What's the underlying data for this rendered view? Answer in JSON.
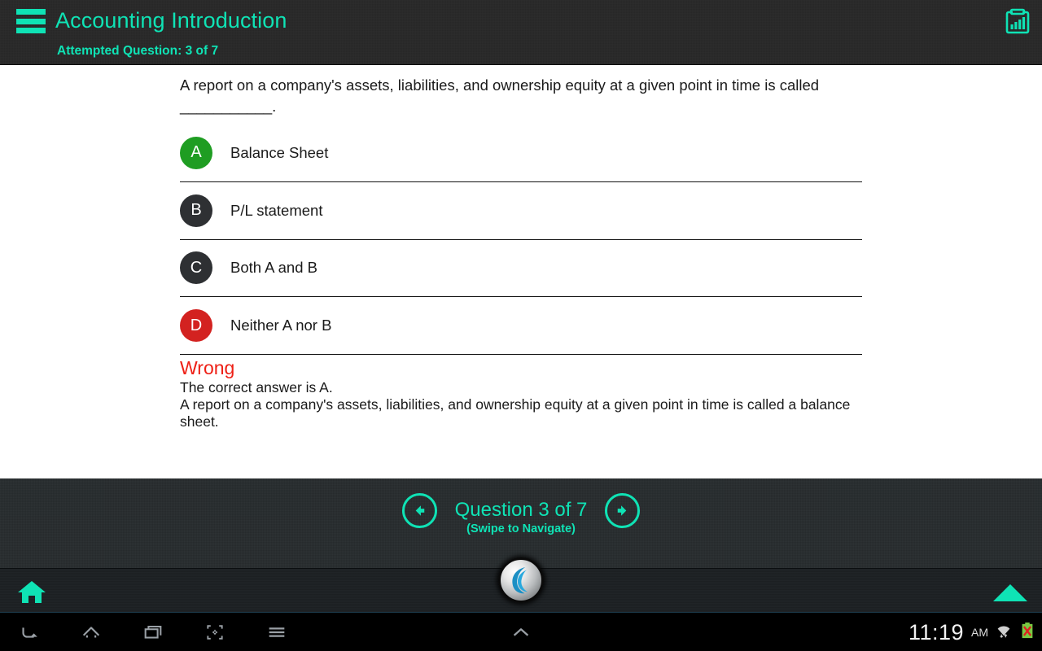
{
  "header": {
    "menu_icon": "hamburger-menu-icon",
    "title": "Accounting Introduction",
    "attempted": "Attempted Question: 3 of 7",
    "results_icon": "clipboard-chart-icon",
    "accent_color": "#0fe3b5",
    "background_color": "#272727"
  },
  "question": {
    "text": "A report on a company's assets, liabilities, and ownership equity at a given point in time is called ___________.",
    "options": [
      {
        "letter": "A",
        "label": "Balance Sheet",
        "state": "correct",
        "color": "#1f9d22"
      },
      {
        "letter": "B",
        "label": "P/L statement",
        "state": "neutral",
        "color": "#2e3033"
      },
      {
        "letter": "C",
        "label": "Both A and B",
        "state": "neutral",
        "color": "#2e3033"
      },
      {
        "letter": "D",
        "label": "Neither A nor B",
        "state": "chosen",
        "color": "#d32220"
      }
    ]
  },
  "verdict": {
    "title": "Wrong",
    "title_color": "#ee2016",
    "correct_line": "The correct answer is A.",
    "explanation": "A report on a company's assets, liabilities, and ownership equity at a given point in time is called a balance sheet."
  },
  "footer": {
    "prev_icon": "arrow-left-circle-icon",
    "next_icon": "arrow-right-circle-icon",
    "question_counter": "Question 3 of  7",
    "swipe_hint": "(Swipe to Navigate)"
  },
  "appbar": {
    "home_icon": "home-icon",
    "up_icon": "triangle-up-icon",
    "browser_orb_icon": "browser-logo-icon"
  },
  "system_bar": {
    "back_icon": "back-arrow-icon",
    "home_icon": "home-outline-icon",
    "recents_icon": "recent-apps-icon",
    "screenshot_icon": "screenshot-icon",
    "menu_icon": "overflow-menu-icon",
    "expand_icon": "chevron-up-icon",
    "clock": "11:19",
    "ampm": "AM",
    "wifi_icon": "wifi-signal-icon",
    "battery_icon": "battery-error-icon"
  }
}
